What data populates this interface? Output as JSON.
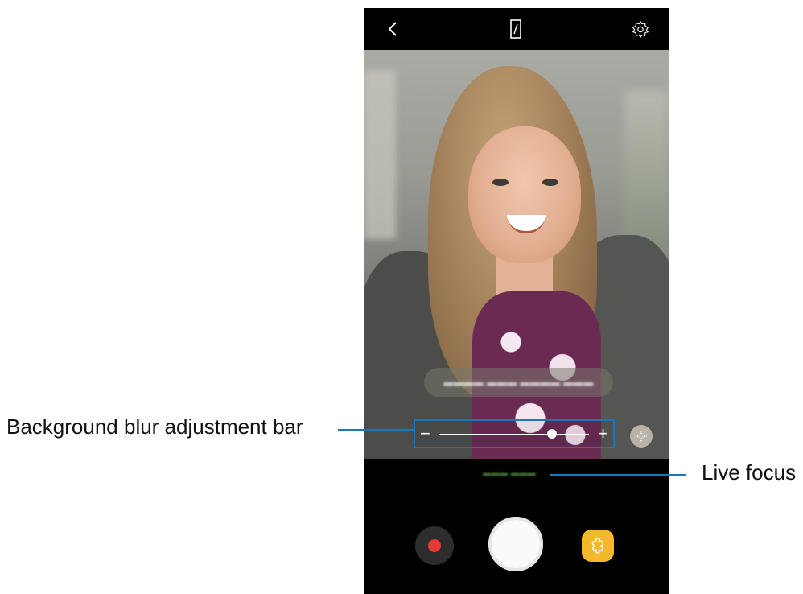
{
  "callouts": {
    "blur_bar": "Background blur adjustment bar",
    "live_focus": "Live focus"
  },
  "camera": {
    "blur_slider": {
      "value": 0.75,
      "min_symbol": "−",
      "max_symbol": "+"
    },
    "colors": {
      "callout": "#1d76b8",
      "record": "#e53935",
      "sticker": "#f4b82b"
    },
    "icons": {
      "back": "back-arrow-icon",
      "ratio": "aspect-ratio-icon",
      "settings": "gear-icon",
      "effect": "sparkle-effect-icon",
      "record": "record-icon",
      "sticker": "flower-sticker-icon"
    }
  }
}
